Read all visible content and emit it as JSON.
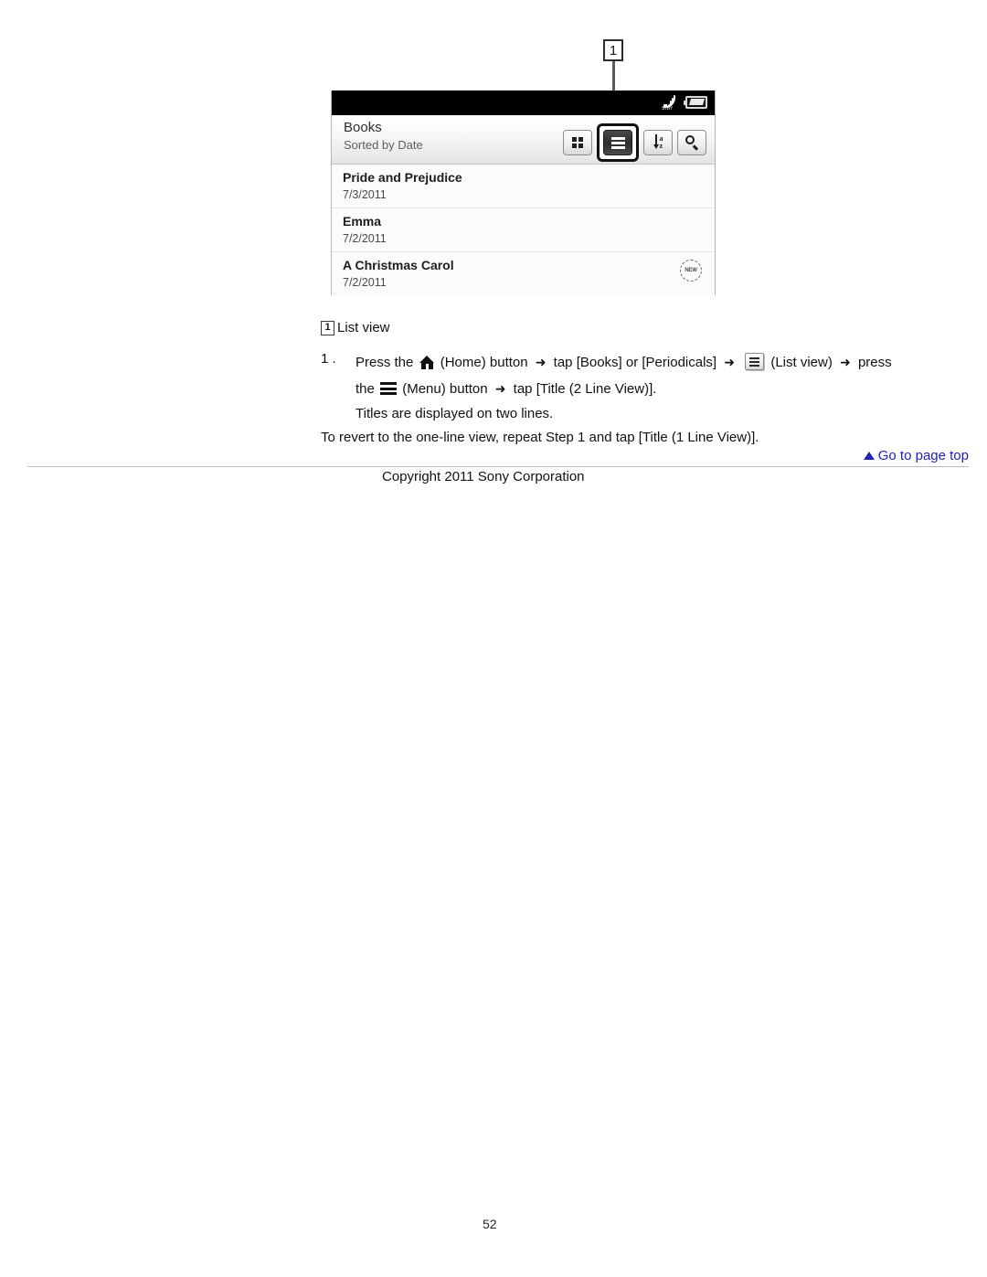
{
  "callout": {
    "number": "1"
  },
  "device": {
    "status_bar": {
      "wifi_icon": "wifi-standby-icon",
      "wifi_label": "STBY",
      "battery_icon": "battery-icon"
    },
    "header": {
      "title": "Books",
      "subtitle": "Sorted by Date",
      "toolbar": [
        {
          "name": "thumbnail-view-button",
          "icon": "grid-icon",
          "active": false
        },
        {
          "name": "list-view-button",
          "icon": "list-icon",
          "active": true
        },
        {
          "name": "sort-button",
          "icon": "sort-az-icon",
          "letter_top": "a",
          "letter_bottom": "z",
          "active": false
        },
        {
          "name": "search-button",
          "icon": "search-icon",
          "active": false
        }
      ]
    },
    "books": [
      {
        "title": "Pride and Prejudice",
        "date": "7/3/2011",
        "badge": ""
      },
      {
        "title": "Emma",
        "date": "7/2/2011",
        "badge": ""
      },
      {
        "title": "A Christmas Carol",
        "date": "7/2/2011",
        "badge": "NEW"
      }
    ]
  },
  "caption": {
    "badge": "1",
    "text": "List view"
  },
  "steps": {
    "number": "1 .",
    "part1": "Press the",
    "home_label": "(Home) button",
    "arrow": "➜",
    "part2": "tap [Books] or [Periodicals]",
    "listview_label": "(List view)",
    "part3": "press",
    "line2_pre": "the",
    "menu_label": "(Menu) button",
    "line2_post": "tap [Title (2 Line View)].",
    "result": "Titles are displayed on two lines.",
    "revert": "To revert to the one-line view, repeat Step 1 and tap [Title (1 Line View)]."
  },
  "footer": {
    "goto_top": "Go to page top",
    "goto_top_icon": "triangle-up-icon",
    "copyright": "Copyright 2011 Sony Corporation",
    "page_number": "52"
  }
}
